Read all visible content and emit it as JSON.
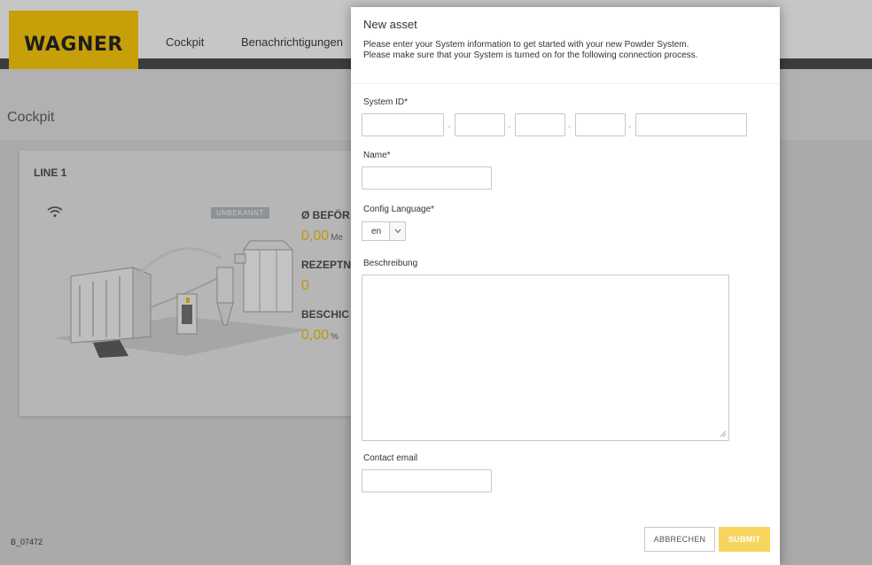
{
  "app": {
    "logo_text": "WAGNER",
    "nav": {
      "cockpit": "Cockpit",
      "notifications": "Benachrichtigungen"
    },
    "page_title": "Cockpit",
    "footer_code": "B_07472"
  },
  "card": {
    "title": "LINE 1",
    "status_badge": "UNBEKANNT",
    "metrics": [
      {
        "label": "Ø BEFÖR",
        "value": "0,00",
        "unit": "Me"
      },
      {
        "label": "REZEPTN",
        "value": "0",
        "unit": ""
      },
      {
        "label": "BESCHIC",
        "value": "0,00",
        "unit": "%"
      }
    ]
  },
  "modal": {
    "title": "New asset",
    "description_line1": "Please enter your System information to get started with your new Powder System.",
    "description_line2": "Please make sure that your System is turned on for the following connection process.",
    "system_id_label": "System ID*",
    "system_id_separator": "-",
    "name_label": "Name*",
    "config_language_label": "Config Language*",
    "config_language_value": "en",
    "description_label": "Beschreibung",
    "contact_email_label": "Contact email",
    "cancel_label": "ABBRECHEN",
    "submit_label": "SUBMIT"
  },
  "colors": {
    "brand_yellow": "#f4c000",
    "metric_yellow": "#e8b800",
    "submit_yellow": "#f7d55d",
    "nav_stripe": "#3e4347"
  },
  "icons": [
    "wifi-icon",
    "chevron-down-icon",
    "resize-grip-icon"
  ]
}
